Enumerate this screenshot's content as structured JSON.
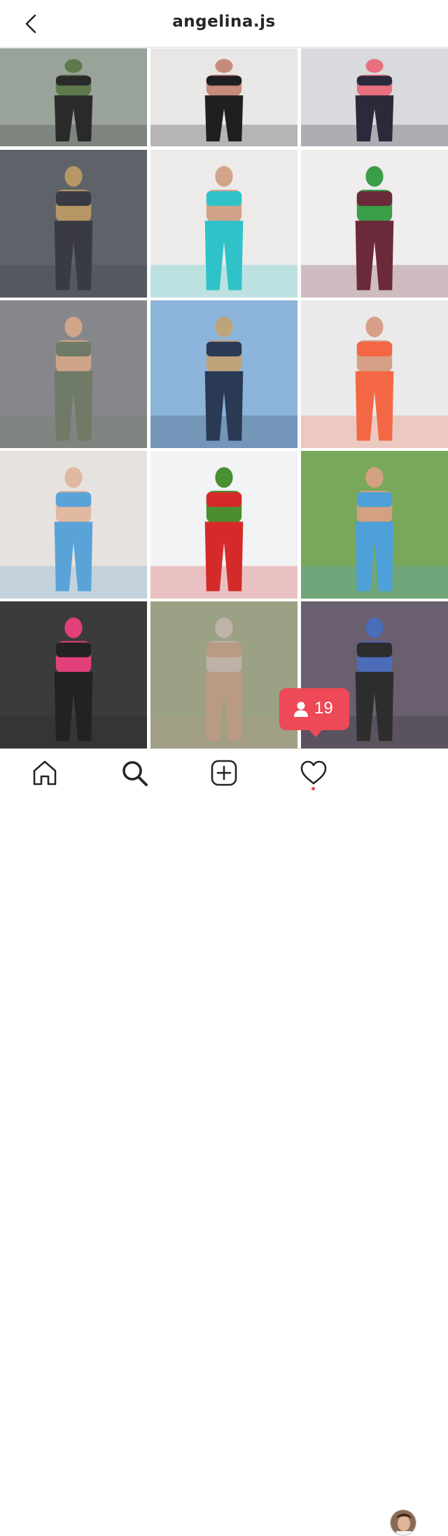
{
  "header": {
    "title": "angelina.js",
    "back_icon": "chevron-left-icon"
  },
  "grid": {
    "columns": 3,
    "rows": 5,
    "tiles": [
      {
        "name": "photo-1",
        "bg": "#9aa39a",
        "fg": "#2a2a2a",
        "accent": "#5f7a4a"
      },
      {
        "name": "photo-2",
        "bg": "#e9e6e6",
        "fg": "#1f1f1f",
        "accent": "#c78b7a"
      },
      {
        "name": "photo-3",
        "bg": "#d8dadd",
        "fg": "#2b2a3b",
        "accent": "#e8707f"
      },
      {
        "name": "photo-4",
        "bg": "#5d6368",
        "fg": "#3a3a44",
        "accent": "#b79766"
      },
      {
        "name": "photo-5",
        "bg": "#ecebea",
        "fg": "#2fc3c9",
        "accent": "#d2a389"
      },
      {
        "name": "photo-6",
        "bg": "#efeded",
        "fg": "#6b2a3a",
        "accent": "#3a9d48"
      },
      {
        "name": "photo-7",
        "bg": "#86878a",
        "fg": "#6f7a67",
        "accent": "#cfa58a"
      },
      {
        "name": "photo-8",
        "bg": "#8db4db",
        "fg": "#2a3a55",
        "accent": "#bfa47a"
      },
      {
        "name": "photo-9",
        "bg": "#eaeaea",
        "fg": "#f46744",
        "accent": "#d6a088"
      },
      {
        "name": "photo-10",
        "bg": "#e6e2df",
        "fg": "#5aa3d8",
        "accent": "#e1b8a0"
      },
      {
        "name": "photo-11",
        "bg": "#f2f3f4",
        "fg": "#d42a2a",
        "accent": "#4a8f2f"
      },
      {
        "name": "photo-12",
        "bg": "#7aa85a",
        "fg": "#4da0d8",
        "accent": "#d3a083"
      },
      {
        "name": "photo-13",
        "bg": "#3b3b3b",
        "fg": "#222222",
        "accent": "#e2407a"
      },
      {
        "name": "photo-14",
        "bg": "#9aa184",
        "fg": "#b99a84",
        "accent": "#bfb2a6"
      },
      {
        "name": "photo-15",
        "bg": "#6a5f6f",
        "fg": "#2d2d2d",
        "accent": "#4b6cb8"
      }
    ]
  },
  "notification": {
    "icon": "person-icon",
    "count": "19"
  },
  "nav": {
    "items": [
      {
        "name": "home",
        "icon": "home-icon"
      },
      {
        "name": "search",
        "icon": "search-icon"
      },
      {
        "name": "new-post",
        "icon": "add-square-icon"
      },
      {
        "name": "activity",
        "icon": "heart-icon"
      },
      {
        "name": "profile",
        "icon": "avatar"
      }
    ],
    "activity_dot_color": "#ed4956"
  }
}
